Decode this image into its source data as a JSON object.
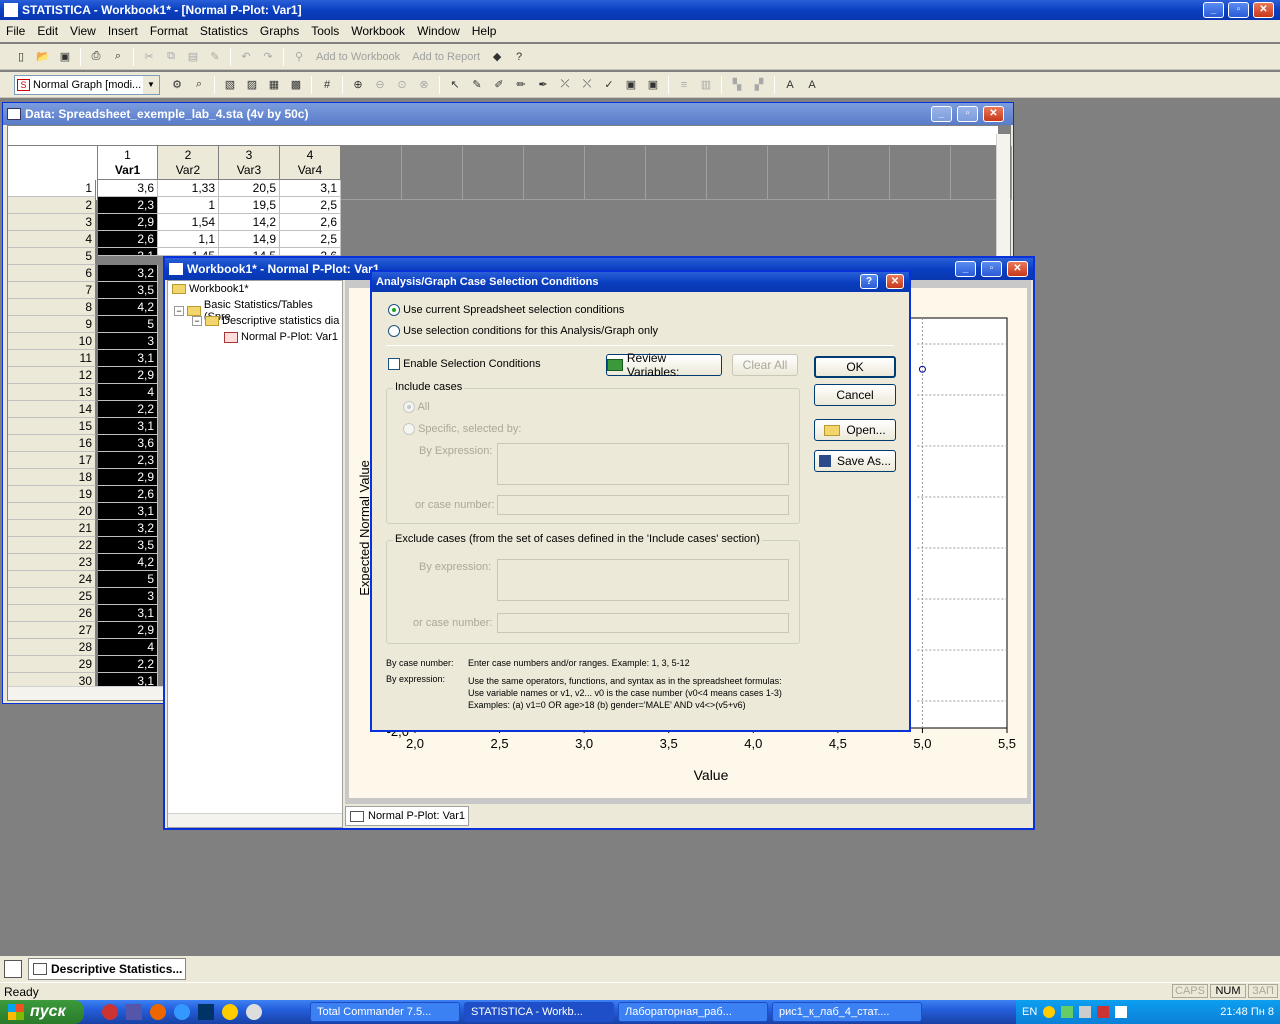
{
  "app": {
    "title": "STATISTICA - Workbook1* - [Normal P-Plot: Var1]"
  },
  "menu": [
    "File",
    "Edit",
    "View",
    "Insert",
    "Format",
    "Statistics",
    "Graphs",
    "Tools",
    "Workbook",
    "Window",
    "Help"
  ],
  "toolbar": {
    "add_to_workbook": "Add to Workbook",
    "add_to_report": "Add to Report",
    "graph_combo": "Normal Graph [modi..."
  },
  "spreadsheet": {
    "title": "Data: Spreadsheet_exemple_lab_4.sta (4v by 50c)",
    "columns": [
      {
        "num": "1",
        "name": "Var1"
      },
      {
        "num": "2",
        "name": "Var2"
      },
      {
        "num": "3",
        "name": "Var3"
      },
      {
        "num": "4",
        "name": "Var4"
      }
    ],
    "rows": [
      {
        "n": "1",
        "v": [
          "3,6",
          "1,33",
          "20,5",
          "3,1"
        ]
      },
      {
        "n": "2",
        "v": [
          "2,3",
          "1",
          "19,5",
          "2,5"
        ]
      },
      {
        "n": "3",
        "v": [
          "2,9",
          "1,54",
          "14,2",
          "2,6"
        ]
      },
      {
        "n": "4",
        "v": [
          "2,6",
          "1,1",
          "14,9",
          "2,5"
        ]
      },
      {
        "n": "5",
        "v": [
          "3,1",
          "1,45",
          "14,5",
          "2,6"
        ]
      },
      {
        "n": "6",
        "v": [
          "3,2",
          "",
          "",
          ""
        ]
      },
      {
        "n": "7",
        "v": [
          "3,5",
          "",
          "",
          ""
        ]
      },
      {
        "n": "8",
        "v": [
          "4,2",
          "",
          "",
          ""
        ]
      },
      {
        "n": "9",
        "v": [
          "5",
          "",
          "",
          ""
        ]
      },
      {
        "n": "10",
        "v": [
          "3",
          "",
          "",
          ""
        ]
      },
      {
        "n": "11",
        "v": [
          "3,1",
          "",
          "",
          ""
        ]
      },
      {
        "n": "12",
        "v": [
          "2,9",
          "",
          "",
          ""
        ]
      },
      {
        "n": "13",
        "v": [
          "4",
          "",
          "",
          ""
        ]
      },
      {
        "n": "14",
        "v": [
          "2,2",
          "",
          "",
          ""
        ]
      },
      {
        "n": "15",
        "v": [
          "3,1",
          "",
          "",
          ""
        ]
      },
      {
        "n": "16",
        "v": [
          "3,6",
          "",
          "",
          ""
        ]
      },
      {
        "n": "17",
        "v": [
          "2,3",
          "",
          "",
          ""
        ]
      },
      {
        "n": "18",
        "v": [
          "2,9",
          "",
          "",
          ""
        ]
      },
      {
        "n": "19",
        "v": [
          "2,6",
          "",
          "",
          ""
        ]
      },
      {
        "n": "20",
        "v": [
          "3,1",
          "",
          "",
          ""
        ]
      },
      {
        "n": "21",
        "v": [
          "3,2",
          "",
          "",
          ""
        ]
      },
      {
        "n": "22",
        "v": [
          "3,5",
          "",
          "",
          ""
        ]
      },
      {
        "n": "23",
        "v": [
          "4,2",
          "",
          "",
          ""
        ]
      },
      {
        "n": "24",
        "v": [
          "5",
          "",
          "",
          ""
        ]
      },
      {
        "n": "25",
        "v": [
          "3",
          "",
          "",
          ""
        ]
      },
      {
        "n": "26",
        "v": [
          "3,1",
          "",
          "",
          ""
        ]
      },
      {
        "n": "27",
        "v": [
          "2,9",
          "",
          "",
          ""
        ]
      },
      {
        "n": "28",
        "v": [
          "4",
          "",
          "",
          ""
        ]
      },
      {
        "n": "29",
        "v": [
          "2,2",
          "",
          "",
          ""
        ]
      },
      {
        "n": "30",
        "v": [
          "3,1",
          "",
          "",
          ""
        ]
      }
    ]
  },
  "workbook": {
    "title": "Workbook1* - Normal P-Plot: Var1",
    "tree": [
      "Workbook1*",
      "Basic Statistics/Tables (Spre",
      "Descriptive statistics dia",
      "Normal P-Plot: Var1"
    ],
    "tab": "Normal P-Plot: Var1"
  },
  "chart_data": {
    "type": "scatter",
    "xlabel": "Value",
    "ylabel": "Expected Normal Value",
    "x_ticks": [
      "2,0",
      "2,5",
      "3,0",
      "3,5",
      "4,0",
      "4,5",
      "5,0",
      "5,5"
    ],
    "y_tick_visible": "-2,0",
    "xlim": [
      2.0,
      5.5
    ],
    "points": [
      {
        "x": 5.0,
        "y": 2.2
      }
    ]
  },
  "dialog": {
    "title": "Analysis/Graph Case Selection Conditions",
    "radio1": "Use current Spreadsheet selection conditions",
    "radio2": "Use selection conditions for this Analysis/Graph only",
    "enable": "Enable Selection Conditions",
    "review": "Review Variables:",
    "clear_all": "Clear All",
    "ok": "OK",
    "cancel": "Cancel",
    "open": "Open...",
    "save_as": "Save As...",
    "include": {
      "label": "Include cases",
      "all": "All",
      "specific": "Specific, selected by:",
      "by_expression": "By Expression:",
      "case_number": "or case number:"
    },
    "exclude": {
      "label": "Exclude cases (from the set of cases defined in the 'Include cases' section)",
      "by_expression": "By expression:",
      "case_number": "or case number:"
    },
    "help": {
      "case_label": "By case number:",
      "case_text": "Enter case numbers and/or ranges.   Example:  1, 3, 5-12",
      "expr_label": "By expression:",
      "expr_line1": "Use the same operators, functions, and syntax as in the spreadsheet formulas:",
      "expr_line2": "Use variable names or v1, v2...    v0 is the case number  (v0<4 means cases 1-3)",
      "expr_line3": "Examples:   (a) v1=0  OR age>18   (b) gender='MALE'  AND v4<>(v5+v6)"
    }
  },
  "bottom": {
    "task_item": "Descriptive Statistics...",
    "status": "Ready",
    "caps": "CAPS",
    "num": "NUM",
    "zap": "ЗАП"
  },
  "taskbar": {
    "start": "пуск",
    "items": [
      "Total Commander 7.5...",
      "STATISTICA - Workb...",
      "Лабораторная_раб...",
      "рис1_к_лаб_4_стат...."
    ],
    "lang": "EN",
    "clock": "21:48 Пн 8"
  }
}
